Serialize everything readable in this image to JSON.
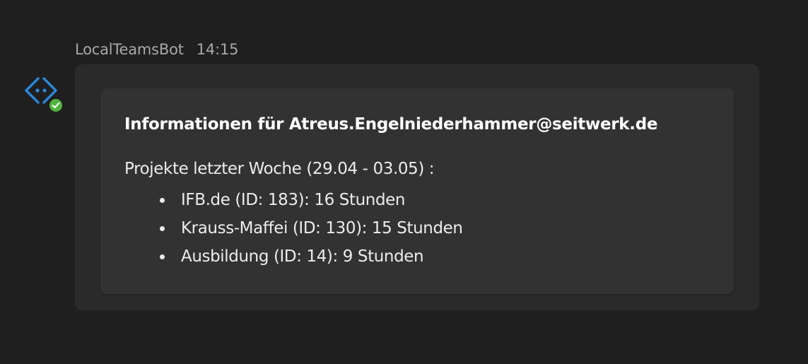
{
  "message": {
    "sender": "LocalTeamsBot",
    "time": "14:15",
    "avatar_icon": "bot-code-icon",
    "status": "available",
    "colors": {
      "avatar_accent": "#2b88d8",
      "status_green": "#53b33f"
    }
  },
  "card": {
    "title": "Informationen für Atreus.Engelniederhammer@seitwerk.de",
    "subtitle": "Projekte letzter Woche (29.04 - 03.05) :",
    "projects": [
      "IFB.de (ID: 183): 16 Stunden",
      "Krauss-Maffei (ID: 130): 15 Stunden",
      "Ausbildung (ID: 14): 9 Stunden"
    ]
  }
}
